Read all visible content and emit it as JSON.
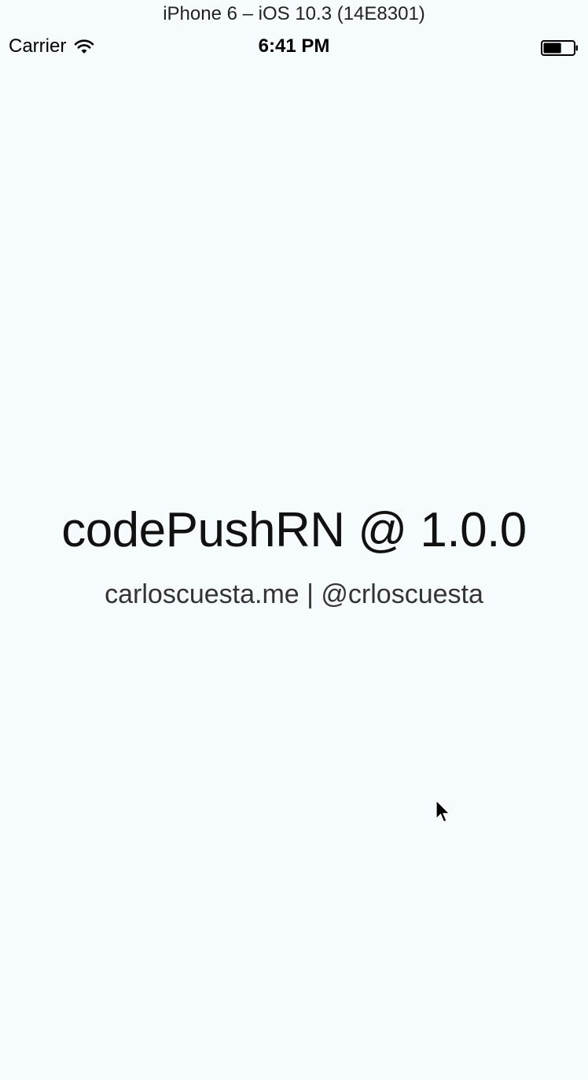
{
  "simulator": {
    "title": "iPhone 6 – iOS 10.3 (14E8301)"
  },
  "status_bar": {
    "carrier": "Carrier",
    "time": "6:41 PM",
    "battery_level": 0.6,
    "icons": [
      "wifi-icon",
      "battery-icon"
    ]
  },
  "app": {
    "title": "codePushRN @ 1.0.0",
    "subtitle": "carloscuesta.me | @crloscuesta"
  },
  "colors": {
    "background": "#f6fbfd",
    "text": "#111111",
    "subtitle_text": "#333333"
  },
  "cursor": {
    "icon": "mouse-pointer-icon"
  }
}
